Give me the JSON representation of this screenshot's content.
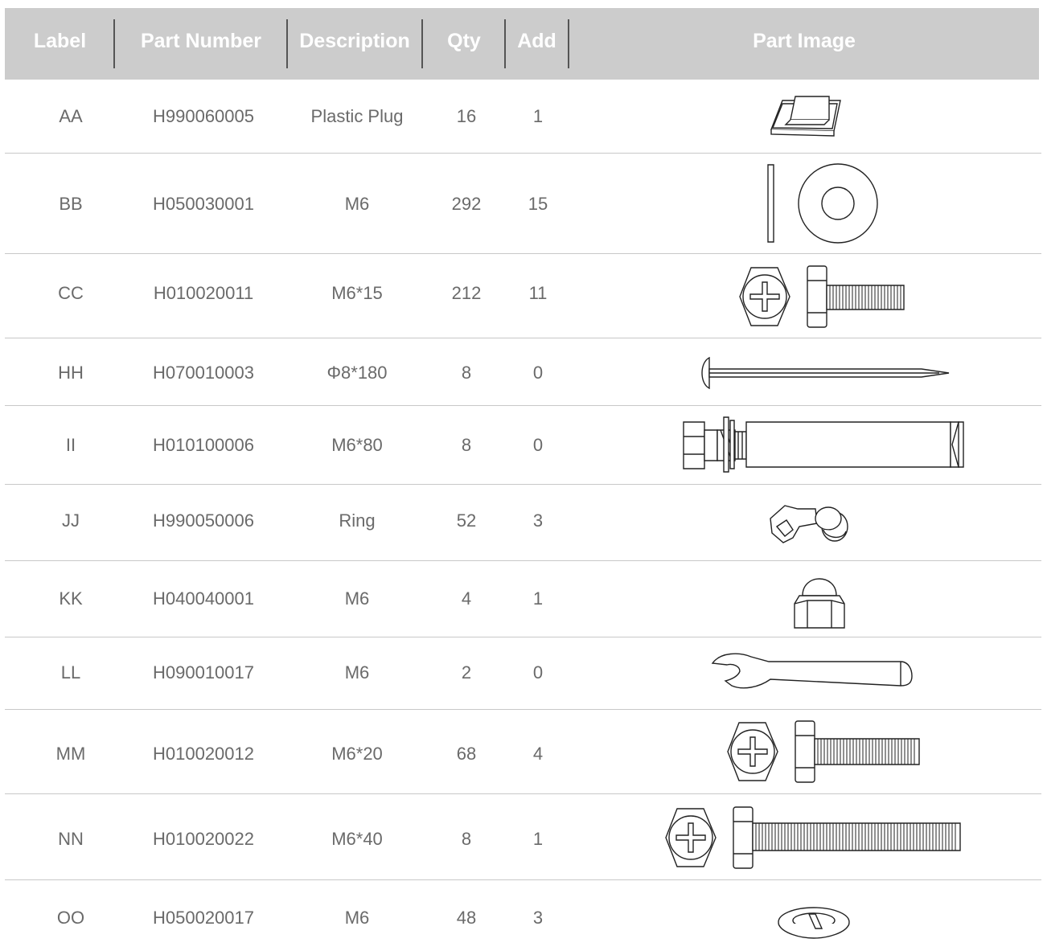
{
  "headers": {
    "label": "Label",
    "part_number": "Part Number",
    "description": "Description",
    "qty": "Qty",
    "add": "Add",
    "part_image": "Part Image"
  },
  "rows": [
    {
      "label": "AA",
      "part_number": "H990060005",
      "description": "Plastic Plug",
      "qty": "16",
      "add": "1",
      "icon": "plastic-plug-icon"
    },
    {
      "label": "BB",
      "part_number": "H050030001",
      "description": "M6",
      "qty": "292",
      "add": "15",
      "icon": "flat-washer-icon"
    },
    {
      "label": "CC",
      "part_number": "H010020011",
      "description": "M6*15",
      "qty": "212",
      "add": "11",
      "icon": "hex-bolt-m6x15-icon"
    },
    {
      "label": "HH",
      "part_number": "H070010003",
      "description": "Φ8*180",
      "qty": "8",
      "add": "0",
      "icon": "ground-stake-icon"
    },
    {
      "label": "II",
      "part_number": "H010100006",
      "description": "M6*80",
      "qty": "8",
      "add": "0",
      "icon": "expansion-anchor-icon"
    },
    {
      "label": "JJ",
      "part_number": "H990050006",
      "description": "Ring",
      "qty": "52",
      "add": "3",
      "icon": "ring-clip-icon"
    },
    {
      "label": "KK",
      "part_number": "H040040001",
      "description": "M6",
      "qty": "4",
      "add": "1",
      "icon": "cap-nut-icon"
    },
    {
      "label": "LL",
      "part_number": "H090010017",
      "description": "M6",
      "qty": "2",
      "add": "0",
      "icon": "wrench-icon"
    },
    {
      "label": "MM",
      "part_number": "H010020012",
      "description": "M6*20",
      "qty": "68",
      "add": "4",
      "icon": "hex-bolt-m6x20-icon"
    },
    {
      "label": "NN",
      "part_number": "H010020022",
      "description": "M6*40",
      "qty": "8",
      "add": "1",
      "icon": "hex-bolt-m6x40-icon"
    },
    {
      "label": "OO",
      "part_number": "H050020017",
      "description": "M6",
      "qty": "48",
      "add": "3",
      "icon": "spring-washer-icon"
    }
  ],
  "colors": {
    "header_bg": "#cccccc",
    "header_text": "#ffffff",
    "separator": "#555555",
    "row_line": "#c8c8c8",
    "cell_text": "#6a6a6a"
  }
}
